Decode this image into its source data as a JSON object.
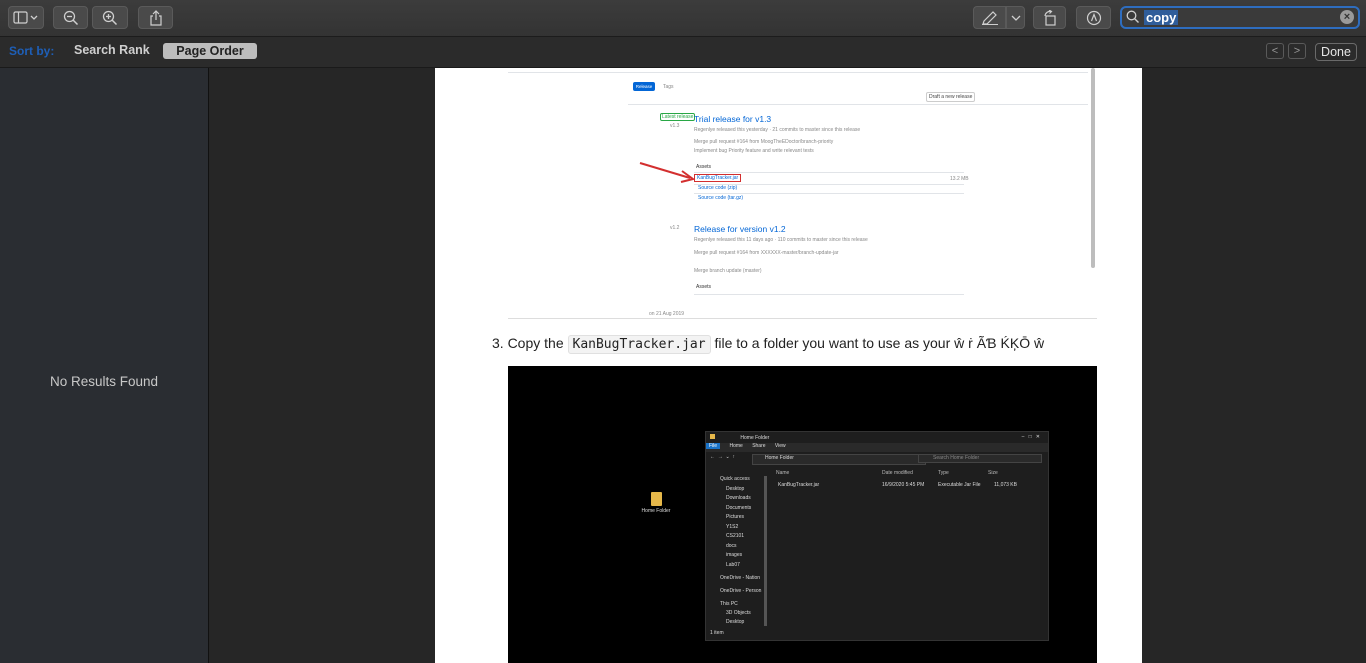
{
  "toolbar": {
    "search_value": "copy",
    "clear_symbol": "×"
  },
  "sortbar": {
    "label": "Sort by:",
    "option_rank": "Search Rank",
    "option_page": "Page Order",
    "prev_symbol": "<",
    "next_symbol": ">",
    "done_label": "Done"
  },
  "sidebar": {
    "message": "No Results Found"
  },
  "document": {
    "github": {
      "tab_release": "Release",
      "tab_tags": "Tags",
      "draft_button": "Draft a new release",
      "release1_title": "Trial release for v1.3",
      "release1_tag": "v1.3",
      "release1_badge": "Latest release",
      "release1_line1": "Regenlye released this yesterday · 21 commits to master since this release",
      "release1_line2": "Merge pull request #164 from MoogTheEDoctor/branch-priority",
      "release1_line3": "Implement bug Priority feature and write relevant tests",
      "assets_label": "Assets",
      "asset_jar": "KanBugTracker.jar",
      "asset_zip": "Source code (zip)",
      "asset_targz": "Source code (tar.gz)",
      "asset_size": "13.2 MB",
      "release2_title": "Release for version v1.2",
      "release2_tag": "v1.2",
      "release2_line1": "Regenlye released this 11 days ago · 110 commits to master since this release",
      "release2_line2": "Merge pull request #164 from XXXXXX-master/branch-update-jar",
      "release2_line3": "Merge branch update (master)",
      "release2_assets": "Assets",
      "date_bottom": "on 21 Aug 2019"
    },
    "step_text_before": "3. Copy the",
    "step_code": "KanBugTracker.jar",
    "step_text_after": "file to a folder you want to use as your ŵ ṙ ÃƁ ḰĶŌ ŵ",
    "screenshot": {
      "desktop_folder_label": "Home Folder",
      "window_title": "Home Folder",
      "ribbon_file": "File",
      "ribbon_home": "Home",
      "ribbon_share": "Share",
      "ribbon_view": "View",
      "address": "Home Folder",
      "search_placeholder": "Search Home Folder",
      "col_name": "Name",
      "col_date": "Date modified",
      "col_type": "Type",
      "col_size": "Size",
      "file_name": "KanBugTracker.jar",
      "file_date": "16/9/2020 5:45 PM",
      "file_type": "Executable Jar File",
      "file_size": "11,073 KB",
      "nav": [
        "Quick access",
        "Desktop",
        "Downloads",
        "Documents",
        "Pictures",
        "Y1S2",
        "CS2101",
        "docs",
        "images",
        "Lab07",
        "OneDrive - Nation",
        "OneDrive - Person",
        "This PC",
        "3D Objects",
        "Desktop"
      ],
      "status": "1 item"
    }
  }
}
